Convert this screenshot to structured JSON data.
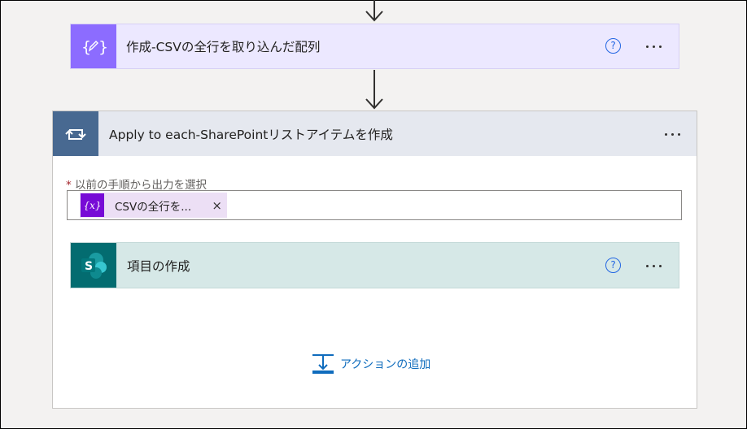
{
  "compose_card": {
    "title": "作成-CSVの全行を取り込んだ配列",
    "icon": "compose-braces-icon",
    "help_glyph": "?",
    "color": "#8c6cff"
  },
  "apply_card": {
    "title": "Apply to each-SharePointリストアイテムを作成",
    "icon": "loop-arrows-icon",
    "color": "#486991"
  },
  "input": {
    "required_mark": "*",
    "label": "以前の手順から出力を選択",
    "token_text": "CSVの全行を...",
    "token_icon_text": "{x}",
    "token_remove": "×"
  },
  "create_item_card": {
    "title": "項目の作成",
    "icon": "sharepoint-icon",
    "help_glyph": "?",
    "color": "#036c70"
  },
  "add_action": {
    "label": "アクションの追加",
    "icon": "add-action-icon"
  }
}
